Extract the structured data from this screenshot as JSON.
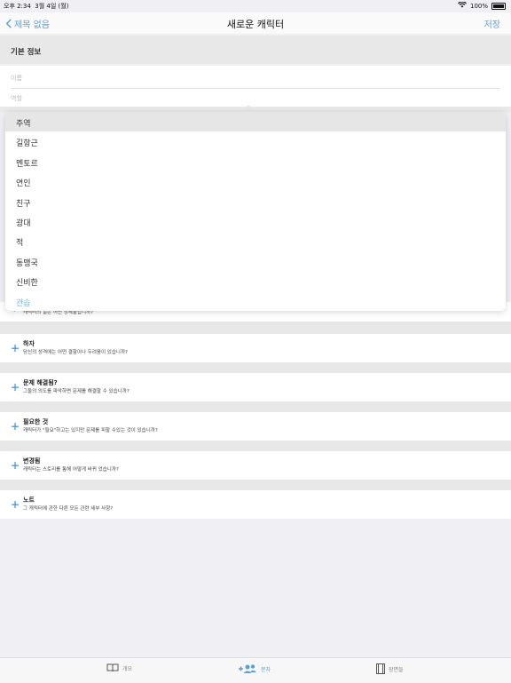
{
  "status_bar": {
    "time": "오후 2:34",
    "date": "3월 4일 (월)",
    "battery": "100%"
  },
  "nav": {
    "back_label": "제목 없음",
    "title": "새로운 캐릭터",
    "save_label": "저장"
  },
  "basic_info": {
    "header": "기본 정보",
    "name_placeholder": "이름",
    "role_placeholder": "역할"
  },
  "role_dropdown": {
    "options": [
      "주역",
      "길항근",
      "멘토르",
      "연인",
      "친구",
      "광대",
      "적",
      "동맹국",
      "신비한",
      "관습"
    ],
    "selected": "주역"
  },
  "partially_hidden_row": {
    "subtitle": "캐릭터의 일은 어떤 정체불입니까?"
  },
  "rows": [
    {
      "title": "하자",
      "subtitle": "당신의 성격에는 어떤 결함이나 두려움이 있습니까?"
    },
    {
      "title": "문제 해결됨?",
      "subtitle": "그들의 의도를 파악하면 문제를 해결할 수 있습니까?"
    },
    {
      "title": "필요한 것",
      "subtitle": "캐릭터가 \"필요\"하고는 있지만 문제를 피할 수있는 것이 있습니까?"
    },
    {
      "title": "변경됨",
      "subtitle": "캐릭터는 스토리를 통해 어떻게 바뀌 었습니까?"
    },
    {
      "title": "노트",
      "subtitle": "그 캐릭터에 관한 다른 모든 관련 세부 사항?"
    }
  ],
  "tabbar": {
    "tabs": [
      "개요",
      "문자",
      "장면들"
    ],
    "active": "문자"
  },
  "colors": {
    "accent": "#5aa0d8",
    "background": "#efeff4"
  },
  "icons": [
    "back-chevron-icon",
    "wifi-icon",
    "battery-icon",
    "plus-icon",
    "book-icon",
    "people-add-icon",
    "film-icon"
  ]
}
